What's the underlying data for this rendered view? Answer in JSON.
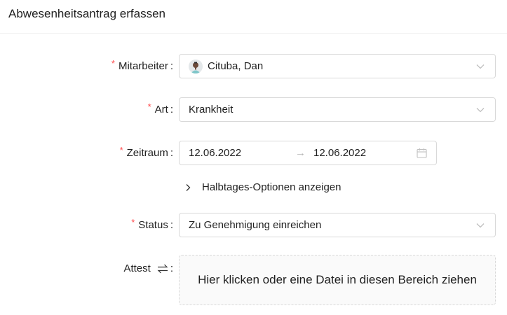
{
  "header": {
    "title": "Abwesenheitsantrag erfassen"
  },
  "form": {
    "employee": {
      "label": "Mitarbeiter",
      "value": "Cituba, Dan",
      "required": true
    },
    "type": {
      "label": "Art",
      "value": "Krankheit",
      "required": true
    },
    "period": {
      "label": "Zeitraum",
      "start": "12.06.2022",
      "end": "12.06.2022",
      "separator": "→",
      "required": true
    },
    "half_day": {
      "label": "Halbtages-Optionen anzeigen"
    },
    "status": {
      "label": "Status",
      "value": "Zu Genehmigung einreichen",
      "required": true
    },
    "certificate": {
      "label": "Attest",
      "dropzone_text": "Hier klicken oder eine Datei in diesen Bereich ziehen"
    },
    "required_marker": "*",
    "colon": ":"
  },
  "colors": {
    "required": "#ff4d4f",
    "border": "#d9d9d9",
    "icon": "#bfbfbf"
  },
  "icons": {
    "select_arrow": "chevron-down-icon",
    "calendar": "calendar-icon",
    "expand": "chevron-right-icon",
    "swap": "swap-icon",
    "avatar": "avatar"
  }
}
